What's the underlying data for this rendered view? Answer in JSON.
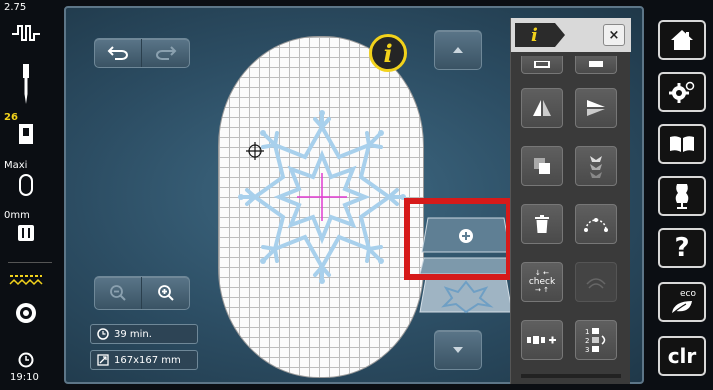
{
  "status_bar": {
    "needle_count": "2.75",
    "stitch_number": "26",
    "presser_foot_label": "Maxi",
    "offset": "0mm",
    "clock": "19:10"
  },
  "workspace": {
    "stitch_time": "39 min.",
    "design_size": "167x167 mm"
  },
  "tool_panel": {
    "info_label": "i",
    "close_label": "×",
    "check_label": "check"
  },
  "right_nav": {
    "eco_label": "eco",
    "help_label": "?",
    "clr_label": "clr"
  },
  "info_button": {
    "label": "i"
  },
  "colors": {
    "accent_yellow": "#f2d21b",
    "workspace_blue": "#2c4d63",
    "stitch_blue": "#a8d0ec",
    "highlight_red": "#d61a1a"
  }
}
